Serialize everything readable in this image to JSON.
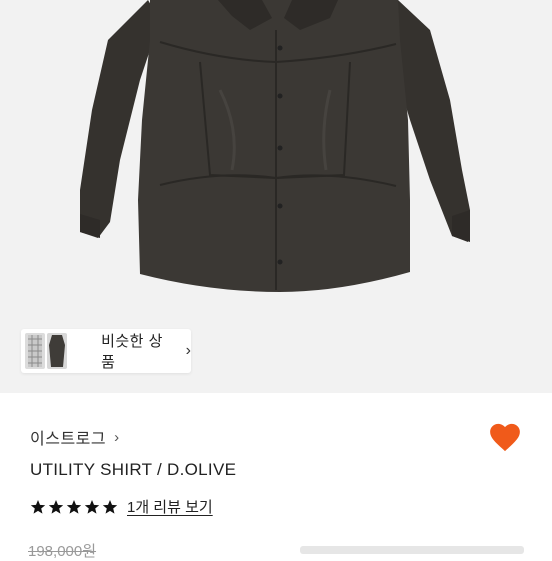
{
  "similar_products": {
    "label": "비슷한 상품"
  },
  "product": {
    "brand": "이스트로그",
    "name": "UTILITY SHIRT / D.OLIVE",
    "rating": {
      "stars": 5,
      "review_link": "1개 리뷰 보기"
    },
    "original_price": "198,000원"
  },
  "colors": {
    "accent": "#f05a1a",
    "shirt": "#3a3733"
  },
  "icons": {
    "favorite": "heart-icon",
    "star": "star-icon"
  }
}
